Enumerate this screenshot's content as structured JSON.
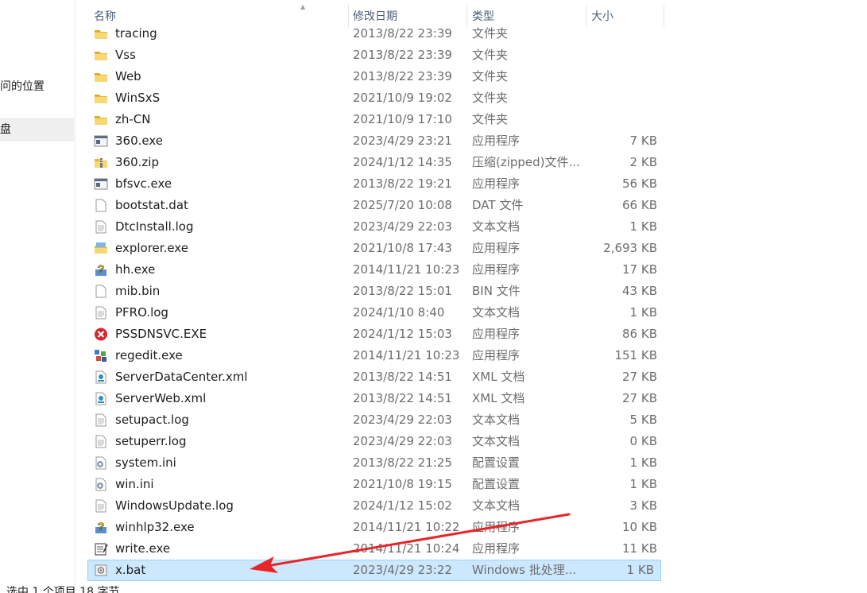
{
  "nav": {
    "recent_label": "问的位置",
    "selected_label": "盘"
  },
  "columns": {
    "name": "名称",
    "date": "修改日期",
    "type": "类型",
    "size": "大小"
  },
  "files": [
    {
      "name": "tracing",
      "date": "2013/8/22 23:39",
      "type": "文件夹",
      "size": "",
      "icon": "folder-icon"
    },
    {
      "name": "Vss",
      "date": "2013/8/22 23:39",
      "type": "文件夹",
      "size": "",
      "icon": "folder-icon"
    },
    {
      "name": "Web",
      "date": "2013/8/22 23:39",
      "type": "文件夹",
      "size": "",
      "icon": "folder-icon"
    },
    {
      "name": "WinSxS",
      "date": "2021/10/9 19:02",
      "type": "文件夹",
      "size": "",
      "icon": "folder-icon"
    },
    {
      "name": "zh-CN",
      "date": "2021/10/9 17:10",
      "type": "文件夹",
      "size": "",
      "icon": "folder-icon"
    },
    {
      "name": "360.exe",
      "date": "2023/4/29 23:21",
      "type": "应用程序",
      "size": "7 KB",
      "icon": "application-icon"
    },
    {
      "name": "360.zip",
      "date": "2024/1/12 14:35",
      "type": "压缩(zipped)文件...",
      "size": "2 KB",
      "icon": "zip-folder-icon"
    },
    {
      "name": "bfsvc.exe",
      "date": "2013/8/22 19:21",
      "type": "应用程序",
      "size": "56 KB",
      "icon": "application-icon"
    },
    {
      "name": "bootstat.dat",
      "date": "2025/7/20 10:08",
      "type": "DAT 文件",
      "size": "66 KB",
      "icon": "blank-file-icon"
    },
    {
      "name": "DtcInstall.log",
      "date": "2023/4/29 22:03",
      "type": "文本文档",
      "size": "1 KB",
      "icon": "text-file-icon"
    },
    {
      "name": "explorer.exe",
      "date": "2021/10/8 17:43",
      "type": "应用程序",
      "size": "2,693 KB",
      "icon": "explorer-icon"
    },
    {
      "name": "hh.exe",
      "date": "2014/11/21 10:23",
      "type": "应用程序",
      "size": "17 KB",
      "icon": "help-icon"
    },
    {
      "name": "mib.bin",
      "date": "2013/8/22 15:01",
      "type": "BIN 文件",
      "size": "43 KB",
      "icon": "blank-file-icon"
    },
    {
      "name": "PFRO.log",
      "date": "2024/1/10 8:40",
      "type": "文本文档",
      "size": "1 KB",
      "icon": "text-file-icon"
    },
    {
      "name": "PSSDNSVC.EXE",
      "date": "2024/1/12 15:03",
      "type": "应用程序",
      "size": "86 KB",
      "icon": "error-icon"
    },
    {
      "name": "regedit.exe",
      "date": "2014/11/21 10:23",
      "type": "应用程序",
      "size": "151 KB",
      "icon": "regedit-icon"
    },
    {
      "name": "ServerDataCenter.xml",
      "date": "2013/8/22 14:51",
      "type": "XML 文档",
      "size": "27 KB",
      "icon": "xml-file-icon"
    },
    {
      "name": "ServerWeb.xml",
      "date": "2013/8/22 14:51",
      "type": "XML 文档",
      "size": "27 KB",
      "icon": "xml-file-icon"
    },
    {
      "name": "setupact.log",
      "date": "2023/4/29 22:03",
      "type": "文本文档",
      "size": "5 KB",
      "icon": "text-file-icon"
    },
    {
      "name": "setuperr.log",
      "date": "2023/4/29 22:03",
      "type": "文本文档",
      "size": "0 KB",
      "icon": "text-file-icon"
    },
    {
      "name": "system.ini",
      "date": "2013/8/22 21:25",
      "type": "配置设置",
      "size": "1 KB",
      "icon": "settings-file-icon"
    },
    {
      "name": "win.ini",
      "date": "2021/10/8 19:15",
      "type": "配置设置",
      "size": "1 KB",
      "icon": "settings-file-icon"
    },
    {
      "name": "WindowsUpdate.log",
      "date": "2024/1/12 15:02",
      "type": "文本文档",
      "size": "3 KB",
      "icon": "text-file-icon"
    },
    {
      "name": "winhlp32.exe",
      "date": "2014/11/21 10:22",
      "type": "应用程序",
      "size": "10 KB",
      "icon": "help-icon"
    },
    {
      "name": "write.exe",
      "date": "2014/11/21 10:24",
      "type": "应用程序",
      "size": "11 KB",
      "icon": "write-icon"
    },
    {
      "name": "x.bat",
      "date": "2023/4/29 23:22",
      "type": "Windows 批处理...",
      "size": "1 KB",
      "icon": "batch-file-icon",
      "selected": true
    }
  ],
  "status": {
    "text": "选中 1 个项目  18 字节"
  },
  "colors": {
    "selection": "#cce8ff",
    "selection_border": "#99d1ff",
    "header_text": "#4c607a",
    "annotation_arrow": "#e8262a"
  }
}
